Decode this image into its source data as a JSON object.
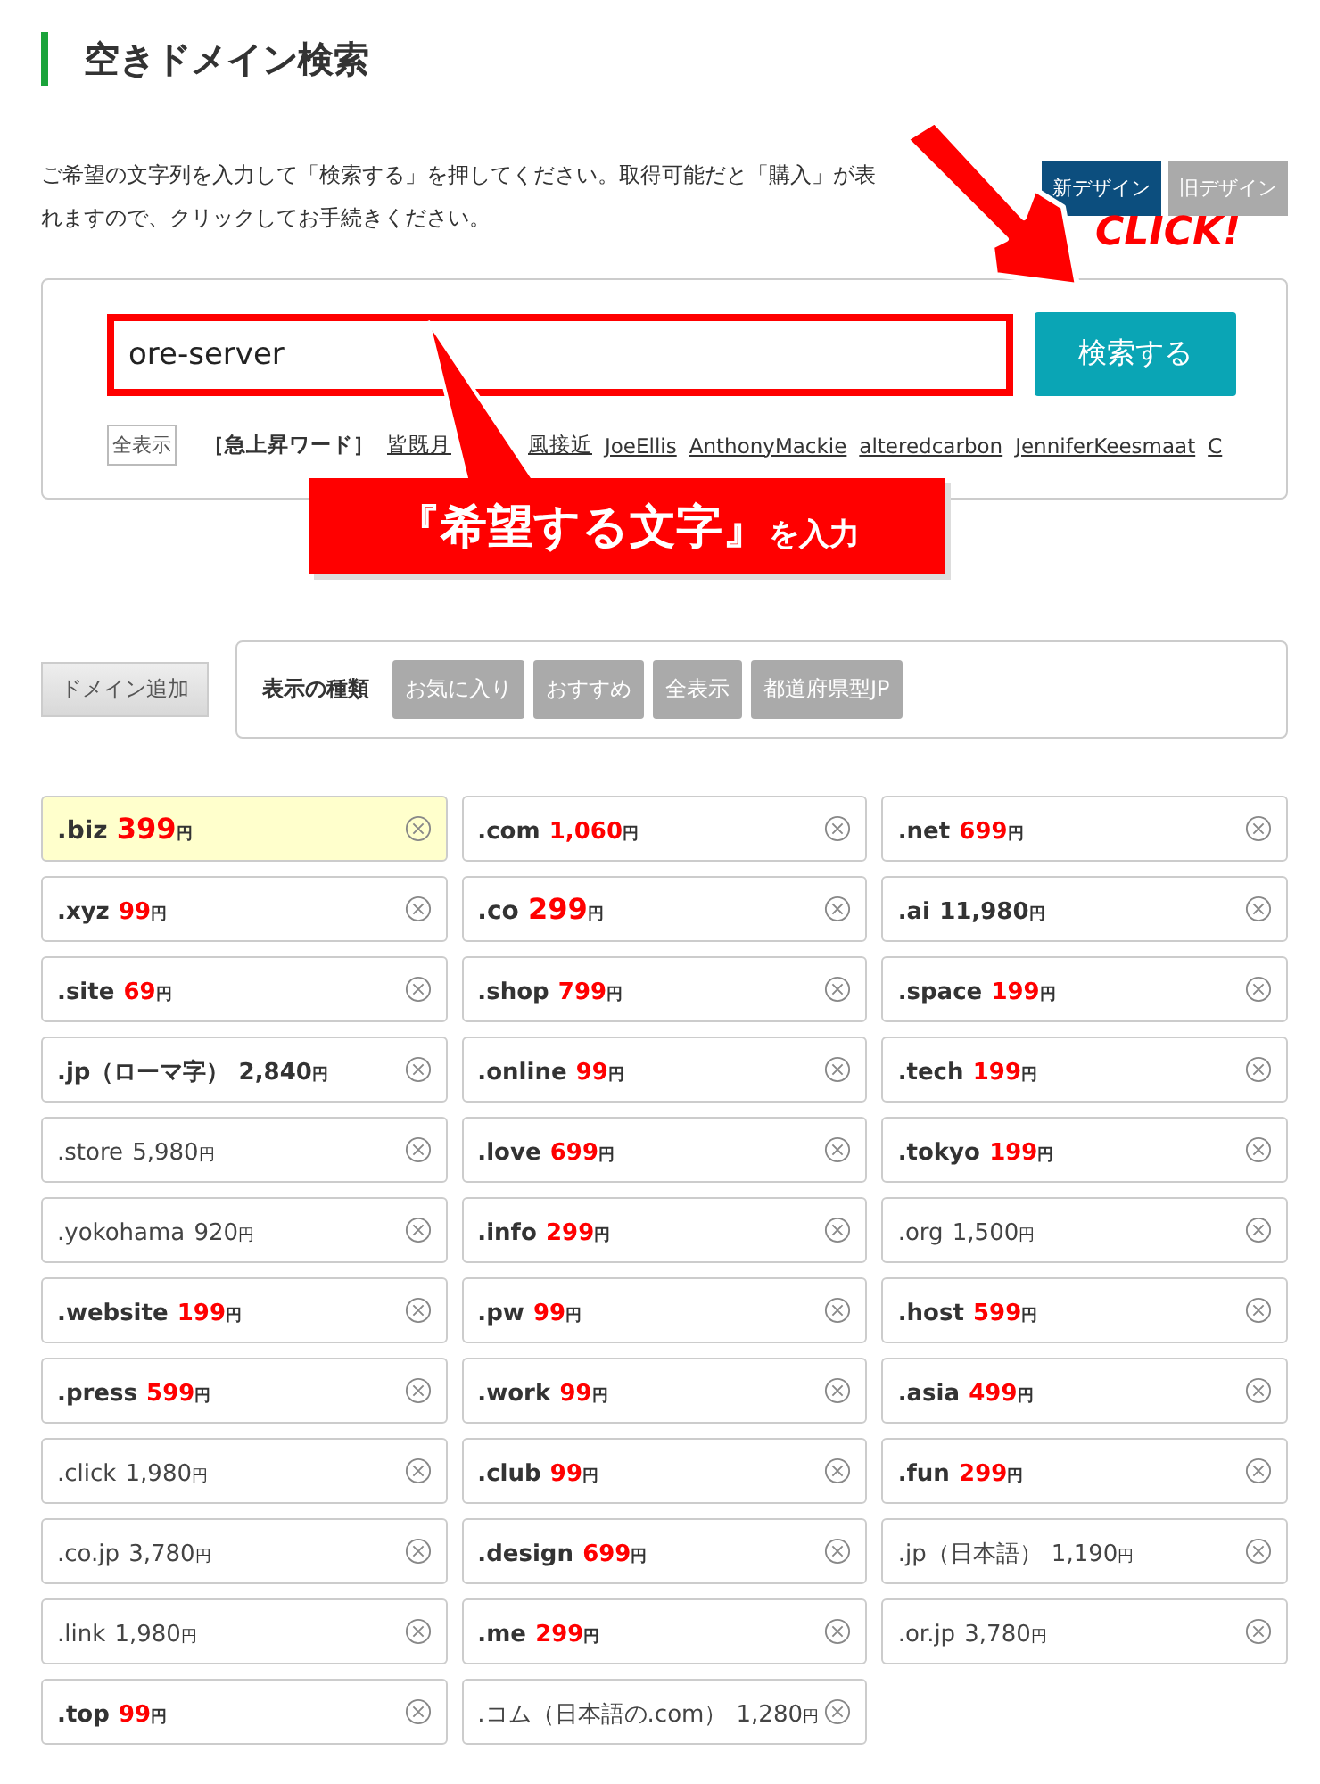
{
  "title": "空きドメイン検索",
  "description": [
    "ご希望の文字列を入力して「検索する」を押してください。取得可能だと「購入」が表",
    "れますので、クリックしてお手続きください。"
  ],
  "design_buttons": [
    {
      "label": "新デザイン",
      "selected": true
    },
    {
      "label": "旧デザイン",
      "selected": false
    }
  ],
  "search": {
    "value": "ore-server",
    "button": "検索する"
  },
  "trending": {
    "show_all": "全表示",
    "label": "［急上昇ワード］",
    "links": [
      "皆既月",
      "風接近",
      "JoeEllis",
      "AnthonyMackie",
      "alteredcarbon",
      "JenniferKeesmaat",
      "C"
    ]
  },
  "callout": {
    "main": "『希望する文字』",
    "sub": "を入力"
  },
  "click_label": "CLICK!",
  "add_button": "ドメイン追加",
  "filter": {
    "label": "表示の種類",
    "chips": [
      "お気に入り",
      "おすすめ",
      "全表示",
      "都道府県型JP"
    ]
  },
  "domains": [
    {
      "name": ".biz",
      "price": "399",
      "unit": "円",
      "kind": "large",
      "highlighted": true
    },
    {
      "name": ".com",
      "price": "1,060",
      "unit": "円",
      "kind": "sale",
      "highlighted": false
    },
    {
      "name": ".net",
      "price": "699",
      "unit": "円",
      "kind": "sale",
      "highlighted": false
    },
    {
      "name": ".xyz",
      "price": "99",
      "unit": "円",
      "kind": "sale",
      "highlighted": false
    },
    {
      "name": ".co",
      "price": "299",
      "unit": "円",
      "kind": "large",
      "highlighted": false
    },
    {
      "name": ".ai",
      "price": "11,980",
      "unit": "円",
      "kind": "bold",
      "highlighted": false
    },
    {
      "name": ".site",
      "price": "69",
      "unit": "円",
      "kind": "sale",
      "highlighted": false
    },
    {
      "name": ".shop",
      "price": "799",
      "unit": "円",
      "kind": "sale",
      "highlighted": false
    },
    {
      "name": ".space",
      "price": "199",
      "unit": "円",
      "kind": "sale",
      "highlighted": false
    },
    {
      "name": ".jp（ローマ字）",
      "price": "2,840",
      "unit": "円",
      "kind": "bold",
      "highlighted": false
    },
    {
      "name": ".online",
      "price": "99",
      "unit": "円",
      "kind": "sale",
      "highlighted": false
    },
    {
      "name": ".tech",
      "price": "199",
      "unit": "円",
      "kind": "sale",
      "highlighted": false
    },
    {
      "name": ".store",
      "price": "5,980",
      "unit": "円",
      "kind": "plain",
      "highlighted": false
    },
    {
      "name": ".love",
      "price": "699",
      "unit": "円",
      "kind": "sale",
      "highlighted": false
    },
    {
      "name": ".tokyo",
      "price": "199",
      "unit": "円",
      "kind": "sale",
      "highlighted": false
    },
    {
      "name": ".yokohama",
      "price": "920",
      "unit": "円",
      "kind": "plain",
      "highlighted": false
    },
    {
      "name": ".info",
      "price": "299",
      "unit": "円",
      "kind": "sale",
      "highlighted": false
    },
    {
      "name": ".org",
      "price": "1,500",
      "unit": "円",
      "kind": "plain",
      "highlighted": false
    },
    {
      "name": ".website",
      "price": "199",
      "unit": "円",
      "kind": "sale",
      "highlighted": false
    },
    {
      "name": ".pw",
      "price": "99",
      "unit": "円",
      "kind": "sale",
      "highlighted": false
    },
    {
      "name": ".host",
      "price": "599",
      "unit": "円",
      "kind": "sale",
      "highlighted": false
    },
    {
      "name": ".press",
      "price": "599",
      "unit": "円",
      "kind": "sale",
      "highlighted": false
    },
    {
      "name": ".work",
      "price": "99",
      "unit": "円",
      "kind": "sale",
      "highlighted": false
    },
    {
      "name": ".asia",
      "price": "499",
      "unit": "円",
      "kind": "sale",
      "highlighted": false
    },
    {
      "name": ".click",
      "price": "1,980",
      "unit": "円",
      "kind": "plain",
      "highlighted": false
    },
    {
      "name": ".club",
      "price": "99",
      "unit": "円",
      "kind": "sale",
      "highlighted": false
    },
    {
      "name": ".fun",
      "price": "299",
      "unit": "円",
      "kind": "sale",
      "highlighted": false
    },
    {
      "name": ".co.jp",
      "price": "3,780",
      "unit": "円",
      "kind": "plain",
      "highlighted": false
    },
    {
      "name": ".design",
      "price": "699",
      "unit": "円",
      "kind": "sale",
      "highlighted": false
    },
    {
      "name": ".jp（日本語）",
      "price": "1,190",
      "unit": "円",
      "kind": "plain",
      "highlighted": false
    },
    {
      "name": ".link",
      "price": "1,980",
      "unit": "円",
      "kind": "plain",
      "highlighted": false
    },
    {
      "name": ".me",
      "price": "299",
      "unit": "円",
      "kind": "sale",
      "highlighted": false
    },
    {
      "name": ".or.jp",
      "price": "3,780",
      "unit": "円",
      "kind": "plain",
      "highlighted": false
    },
    {
      "name": ".top",
      "price": "99",
      "unit": "円",
      "kind": "sale",
      "highlighted": false
    },
    {
      "name": ".コム（日本語の.com）",
      "price": "1,280",
      "unit": "円",
      "kind": "plain",
      "highlighted": false
    }
  ]
}
